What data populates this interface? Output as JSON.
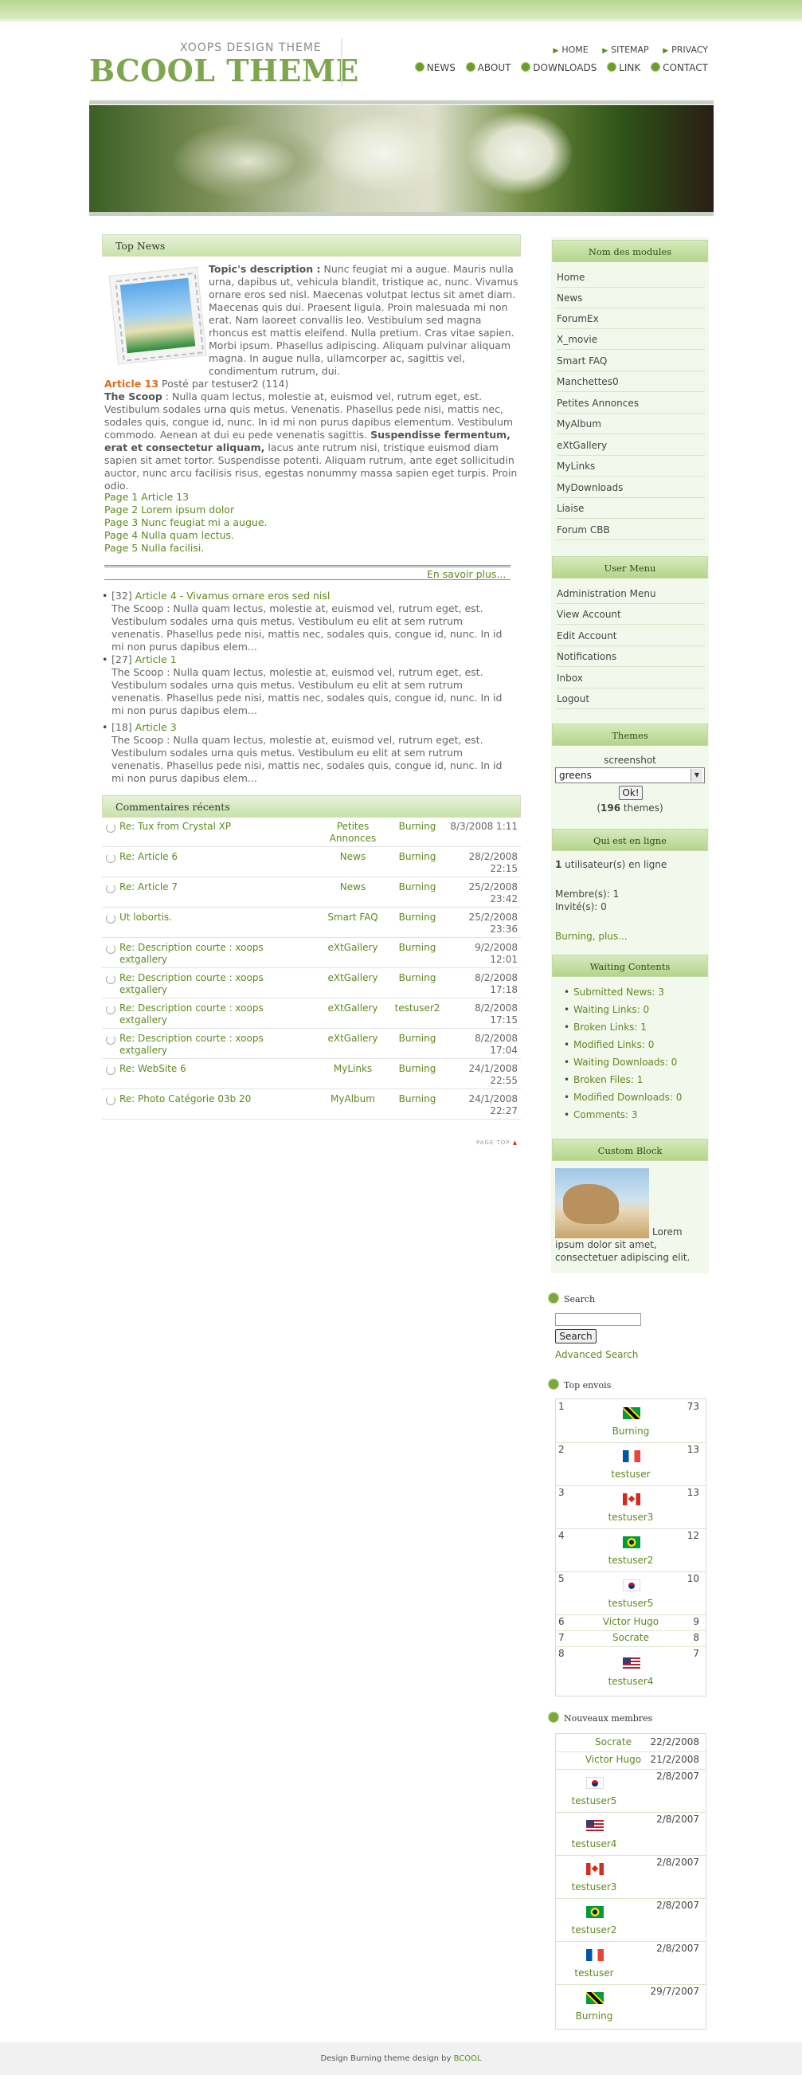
{
  "header": {
    "subtitle": "XOOPS DESIGN THEME",
    "title": "BCOOL THEME",
    "nav_top": [
      "HOME",
      "SITEMAP",
      "PRIVACY"
    ],
    "nav_main": [
      "NEWS",
      "ABOUT",
      "DOWNLOADS",
      "LINK",
      "CONTACT"
    ]
  },
  "top_news": {
    "heading": "Top News",
    "topic_label": "Topic's description :",
    "topic_text": "Nunc feugiat mi a augue. Mauris nulla urna, dapibus ut, vehicula blandit, tristique ac, nunc. Vivamus ornare eros sed nisl. Maecenas volutpat lectus sit amet diam. Maecenas quis dui. Praesent ligula. Proin malesuada mi non erat. Nam laoreet convallis leo. Vestibulum sed magna rhoncus est mattis eleifend. Nulla pretium. Cras vitae sapien. Morbi ipsum. Phasellus adipiscing. Aliquam pulvinar aliquam magna. In augue nulla, ullamcorper ac, sagittis vel, condimentum rutrum, dui.",
    "article_title": "Article 13",
    "article_meta": "Posté par testuser2 (114)",
    "scoop_label": "The Scoop",
    "scoop_text_1": ": Nulla quam lectus, molestie at, euismod vel, rutrum eget, est. Vestibulum sodales urna quis metus. Venenatis. Phasellus pede nisi, mattis nec, sodales quis, congue id, nunc. In id mi non purus dapibus elementum. Vestibulum commodo. Aenean at dui eu pede venenatis sagittis.",
    "scoop_bold": "Suspendisse fermentum, erat et consectetur aliquam,",
    "scoop_text_2": "lacus ante rutrum nisi, tristique euismod diam sapien sit amet tortor. Suspendisse potenti. Aliquam rutrum, ante eget sollicitudin auctor, nunc arcu facilisis risus, egestas nonummy massa sapien eget turpis. Proin odio.",
    "pages": [
      "Page 1 Article 13",
      "Page 2 Lorem ipsum dolor",
      "Page 3 Nunc feugiat mi a augue.",
      "Page 4 Nulla quam lectus.",
      "Page 5 Nulla facilisi."
    ],
    "read_more": "En savoir plus...",
    "related": [
      {
        "id": "[32]",
        "title": "Article 4 - Vivamus ornare eros sed nisl",
        "text": "The Scoop : Nulla quam lectus, molestie at, euismod vel, rutrum eget, est. Vestibulum sodales urna quis metus. Vestibulum eu elit at sem rutrum venenatis. Phasellus pede nisi, mattis nec, sodales quis, congue id, nunc. In id mi non purus dapibus elem..."
      },
      {
        "id": "[27]",
        "title": "Article 1",
        "text": "The Scoop : Nulla quam lectus, molestie at, euismod vel, rutrum eget, est. Vestibulum sodales urna quis metus. Vestibulum eu elit at sem rutrum venenatis. Phasellus pede nisi, mattis nec, sodales quis, congue id, nunc. In id mi non purus dapibus elem..."
      },
      {
        "id": "[18]",
        "title": "Article 3",
        "text": "The Scoop : Nulla quam lectus, molestie at, euismod vel, rutrum eget, est. Vestibulum sodales urna quis metus. Vestibulum eu elit at sem rutrum venenatis. Phasellus pede nisi, mattis nec, sodales quis, congue id, nunc. In id mi non purus dapibus elem..."
      }
    ]
  },
  "comments": {
    "heading": "Commentaires récents",
    "rows": [
      {
        "title": "Re: Tux from Crystal XP",
        "module": "Petites Annonces",
        "user": "Burning",
        "date": "8/3/2008 1:11"
      },
      {
        "title": "Re: Article 6",
        "module": "News",
        "user": "Burning",
        "date": "28/2/2008 22:15"
      },
      {
        "title": "Re: Article 7",
        "module": "News",
        "user": "Burning",
        "date": "25/2/2008 23:42"
      },
      {
        "title": "Ut lobortis.",
        "module": "Smart FAQ",
        "user": "Burning",
        "date": "25/2/2008 23:36"
      },
      {
        "title": "Re: Description courte : xoops extgallery",
        "module": "eXtGallery",
        "user": "Burning",
        "date": "9/2/2008 12:01"
      },
      {
        "title": "Re: Description courte : xoops extgallery",
        "module": "eXtGallery",
        "user": "Burning",
        "date": "8/2/2008 17:18"
      },
      {
        "title": "Re: Description courte : xoops extgallery",
        "module": "eXtGallery",
        "user": "testuser2",
        "date": "8/2/2008 17:15"
      },
      {
        "title": "Re: Description courte : xoops extgallery",
        "module": "eXtGallery",
        "user": "Burning",
        "date": "8/2/2008 17:04"
      },
      {
        "title": "Re: WebSite 6",
        "module": "MyLinks",
        "user": "Burning",
        "date": "24/1/2008 22:55"
      },
      {
        "title": "Re: Photo Catégorie 03b 20",
        "module": "MyAlbum",
        "user": "Burning",
        "date": "24/1/2008 22:27"
      }
    ],
    "page_top": "PAGE TOP"
  },
  "modules": {
    "heading": "Nom des modules",
    "items": [
      "Home",
      "News",
      "ForumEx",
      "X_movie",
      "Smart FAQ",
      "Manchettes0",
      "Petites Annonces",
      "MyAlbum",
      "eXtGallery",
      "MyLinks",
      "MyDownloads",
      "Liaise",
      "Forum CBB"
    ]
  },
  "user_menu": {
    "heading": "User Menu",
    "items": [
      "Administration Menu",
      "View Account",
      "Edit Account",
      "Notifications",
      "Inbox",
      "Logout"
    ]
  },
  "themes": {
    "heading": "Themes",
    "label": "screenshot",
    "selected": "greens",
    "button": "Ok!",
    "count_prefix": "(",
    "count": "196",
    "count_suffix": " themes)"
  },
  "online": {
    "heading": "Qui est en ligne",
    "count": "1",
    "count_text": " utilisateur(s) en ligne",
    "members": "Membre(s): 1",
    "guests": "Invité(s): 0",
    "more": "Burning, plus..."
  },
  "waiting": {
    "heading": "Waiting Contents",
    "items": [
      "Submitted News: 3",
      "Waiting Links: 0",
      "Broken Links: 1",
      "Modified Links: 0",
      "Waiting Downloads: 0",
      "Broken Files: 1",
      "Modified Downloads: 0",
      "Comments: 3"
    ]
  },
  "custom": {
    "heading": "Custom Block",
    "text": "Lorem ipsum dolor sit amet, consectetuer adipiscing elit."
  },
  "search": {
    "heading": "Search",
    "button": "Search",
    "advanced": "Advanced Search"
  },
  "top_posters": {
    "heading": "Top envois",
    "rows": [
      {
        "rank": "1",
        "name": "Burning",
        "count": "73",
        "flag": "jm"
      },
      {
        "rank": "2",
        "name": "testuser",
        "count": "13",
        "flag": "fr"
      },
      {
        "rank": "3",
        "name": "testuser3",
        "count": "13",
        "flag": "ca"
      },
      {
        "rank": "4",
        "name": "testuser2",
        "count": "12",
        "flag": "br"
      },
      {
        "rank": "5",
        "name": "testuser5",
        "count": "10",
        "flag": "kr"
      },
      {
        "rank": "6",
        "name": "Victor Hugo",
        "count": "9",
        "flag": ""
      },
      {
        "rank": "7",
        "name": "Socrate",
        "count": "8",
        "flag": ""
      },
      {
        "rank": "8",
        "name": "testuser4",
        "count": "7",
        "flag": "us"
      }
    ]
  },
  "new_members": {
    "heading": "Nouveaux membres",
    "rows": [
      {
        "name": "Socrate",
        "date": "22/2/2008",
        "flag": ""
      },
      {
        "name": "Victor Hugo",
        "date": "21/2/2008",
        "flag": ""
      },
      {
        "name": "testuser5",
        "date": "2/8/2007",
        "flag": "kr"
      },
      {
        "name": "testuser4",
        "date": "2/8/2007",
        "flag": "us"
      },
      {
        "name": "testuser3",
        "date": "2/8/2007",
        "flag": "ca"
      },
      {
        "name": "testuser2",
        "date": "2/8/2007",
        "flag": "br"
      },
      {
        "name": "testuser",
        "date": "2/8/2007",
        "flag": "fr"
      },
      {
        "name": "Burning",
        "date": "29/7/2007",
        "flag": "jm"
      }
    ]
  },
  "footer": {
    "text": "Design Burning theme design by",
    "brand": "BCOOL"
  }
}
